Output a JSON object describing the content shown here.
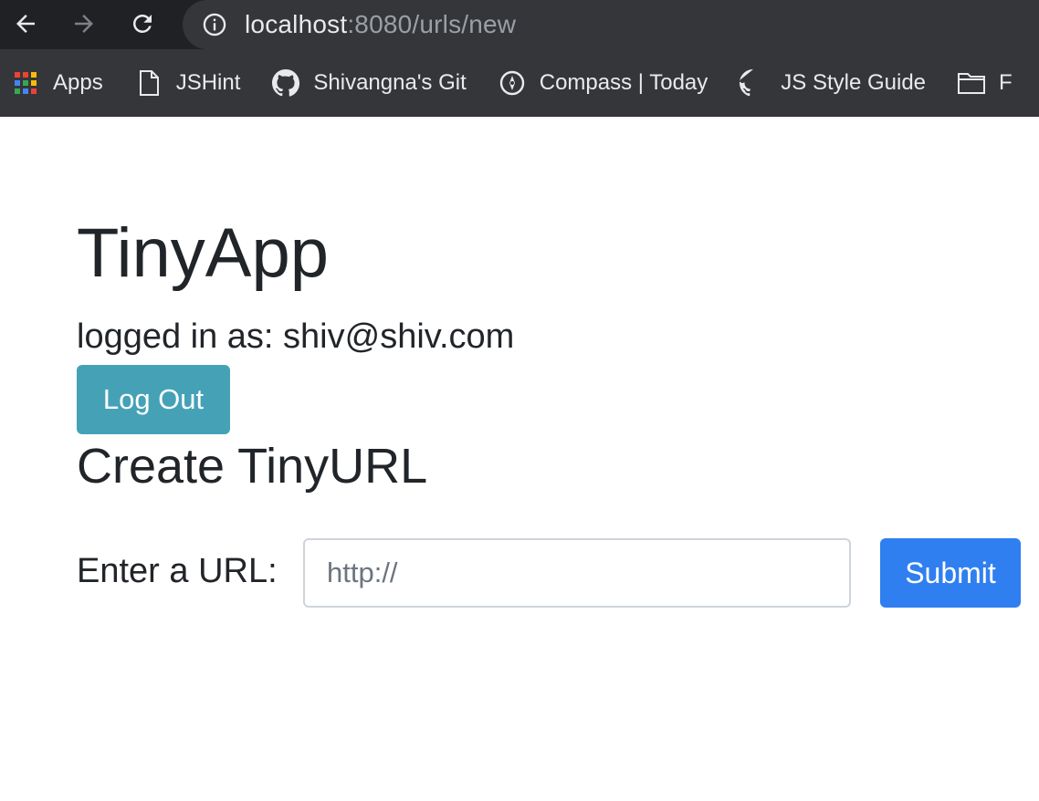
{
  "browser": {
    "url_host": "localhost",
    "url_path": ":8080/urls/new",
    "bookmarks": [
      {
        "label": "Apps",
        "icon": "apps-grid-icon"
      },
      {
        "label": "JSHint",
        "icon": "page-icon"
      },
      {
        "label": "Shivangna's Git",
        "icon": "github-icon"
      },
      {
        "label": "Compass | Today",
        "icon": "compass-icon"
      },
      {
        "label": "JS Style Guide",
        "icon": "github-icon"
      },
      {
        "label": "F",
        "icon": "folder-icon"
      }
    ]
  },
  "page": {
    "app_title": "TinyApp",
    "logged_in_text": "logged in as: shiv@shiv.com",
    "logout_label": "Log Out",
    "create_title": "Create TinyURL",
    "url_label": "Enter a URL:",
    "url_placeholder": "http://",
    "url_value": "",
    "submit_label": "Submit"
  },
  "colors": {
    "chrome_toolbar": "#202124",
    "chrome_bookmarks": "#35363a",
    "logout_button": "#45a2b6",
    "submit_button": "#2f7ff0",
    "text": "#212529"
  }
}
